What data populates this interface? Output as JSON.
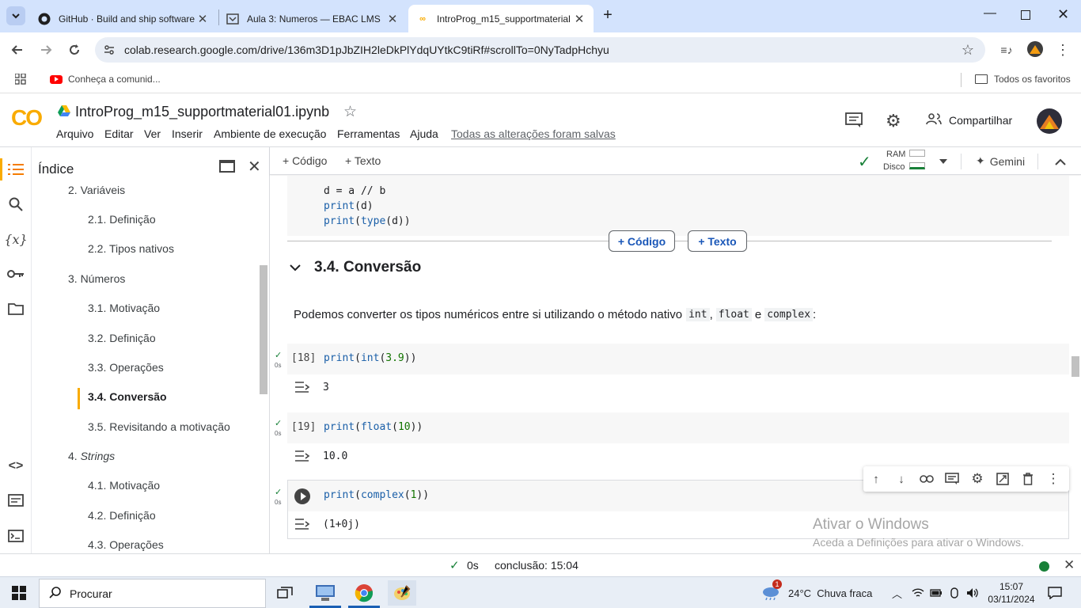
{
  "browser": {
    "tabs": [
      {
        "label": "GitHub · Build and ship software",
        "icon": "github-icon"
      },
      {
        "label": "Aula 3: Numeros — EBAC LMS",
        "icon": "ebac-icon"
      },
      {
        "label": "IntroProg_m15_supportmaterial",
        "icon": "colab-icon"
      }
    ],
    "url": "colab.research.google.com/drive/136m3D1pJbZIH2leDkPlYdqUYtkC9tiRf#scrollTo=0NyTadpHchyu",
    "bookmark": "Conheça a comunid...",
    "all_bookmarks": "Todos os favoritos"
  },
  "colab": {
    "logo": "CO",
    "title": "IntroProg_m15_supportmaterial01.ipynb",
    "menu": [
      "Arquivo",
      "Editar",
      "Ver",
      "Inserir",
      "Ambiente de execução",
      "Ferramentas",
      "Ajuda"
    ],
    "save_status": "Todas as alterações foram salvas",
    "share": "Compartilhar"
  },
  "toc": {
    "title": "Índice",
    "items": [
      {
        "label": "2. Variáveis",
        "level": 1
      },
      {
        "label": "2.1. Definição",
        "level": 2
      },
      {
        "label": "2.2. Tipos nativos",
        "level": 2
      },
      {
        "label": "3. Números",
        "level": 1
      },
      {
        "label": "3.1. Motivação",
        "level": 2
      },
      {
        "label": "3.2. Definição",
        "level": 2
      },
      {
        "label": "3.3. Operações",
        "level": 2
      },
      {
        "label": "3.4. Conversão",
        "level": 2,
        "active": true
      },
      {
        "label": "3.5. Revisitando a motivação",
        "level": 2
      },
      {
        "label": "4. Strings",
        "level": 1,
        "italic_part": "Strings"
      },
      {
        "label": "4.1. Motivação",
        "level": 2
      },
      {
        "label": "4.2. Definição",
        "level": 2
      },
      {
        "label": "4.3. Operações",
        "level": 2
      }
    ]
  },
  "nbtoolbar": {
    "code": "+ Código",
    "text": "+ Texto",
    "ram": "RAM",
    "disk": "Disco",
    "gemini": "Gemini"
  },
  "notebook": {
    "top_code": [
      "d = a // b",
      "print(d)",
      "print(type(d))"
    ],
    "add_code": "+ Código",
    "add_text": "+ Texto",
    "section": "3.4. Conversão",
    "paragraph": "Podemos converter os tipos numéricos entre si utilizando o método nativo",
    "para_code": [
      "int",
      "float",
      "complex"
    ],
    "para_sep1": ",",
    "para_sep2": "e",
    "para_end": ":",
    "cells": [
      {
        "no": "[18]",
        "code": "print(int(3.9))",
        "output": "3",
        "time": "0s"
      },
      {
        "no": "[19]",
        "code": "print(float(10))",
        "output": "10.0",
        "time": "0s"
      },
      {
        "no": "",
        "code": "print(complex(1))",
        "output": "(1+0j)",
        "time": "0s"
      }
    ],
    "watermark_title": "Ativar o Windows",
    "watermark_sub": "Aceda a Definições para ativar o Windows."
  },
  "statusbar": {
    "time": "0s",
    "completion": "conclusão: 15:04"
  },
  "taskbar": {
    "search": "Procurar",
    "weather": "24°C  Chuva fraca",
    "weather_badge": "1",
    "clock_time": "15:07",
    "clock_date": "03/11/2024"
  }
}
